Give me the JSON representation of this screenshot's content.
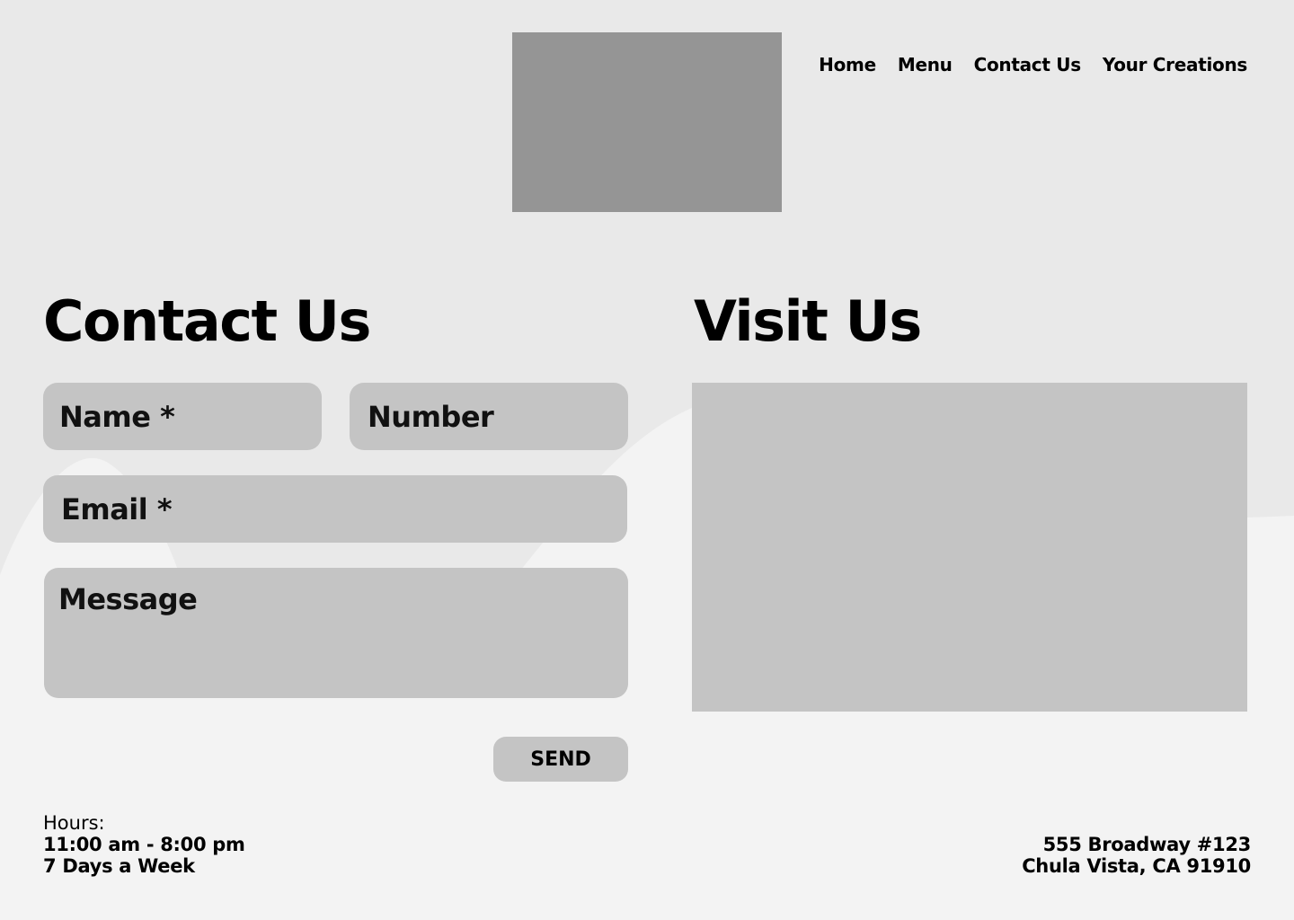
{
  "nav": {
    "items": [
      {
        "label": "Home"
      },
      {
        "label": "Menu"
      },
      {
        "label": "Contact Us"
      },
      {
        "label": "Your Creations"
      }
    ]
  },
  "contact": {
    "title": "Contact Us",
    "name_placeholder": "Name *",
    "number_placeholder": "Number",
    "email_placeholder": "Email *",
    "message_placeholder": "Message",
    "send_label": "SEND"
  },
  "visit": {
    "title": "Visit Us"
  },
  "footer": {
    "hours_label": "Hours:",
    "hours_time": "11:00 am - 8:00 pm",
    "hours_days": "7 Days a Week",
    "address_line1": "555 Broadway #123",
    "address_line2": "Chula Vista, CA 91910"
  },
  "colors": {
    "background": "#e9e9e9",
    "wave": "#f3f3f3",
    "logo_placeholder": "#959595",
    "field": "#c4c4c4"
  }
}
